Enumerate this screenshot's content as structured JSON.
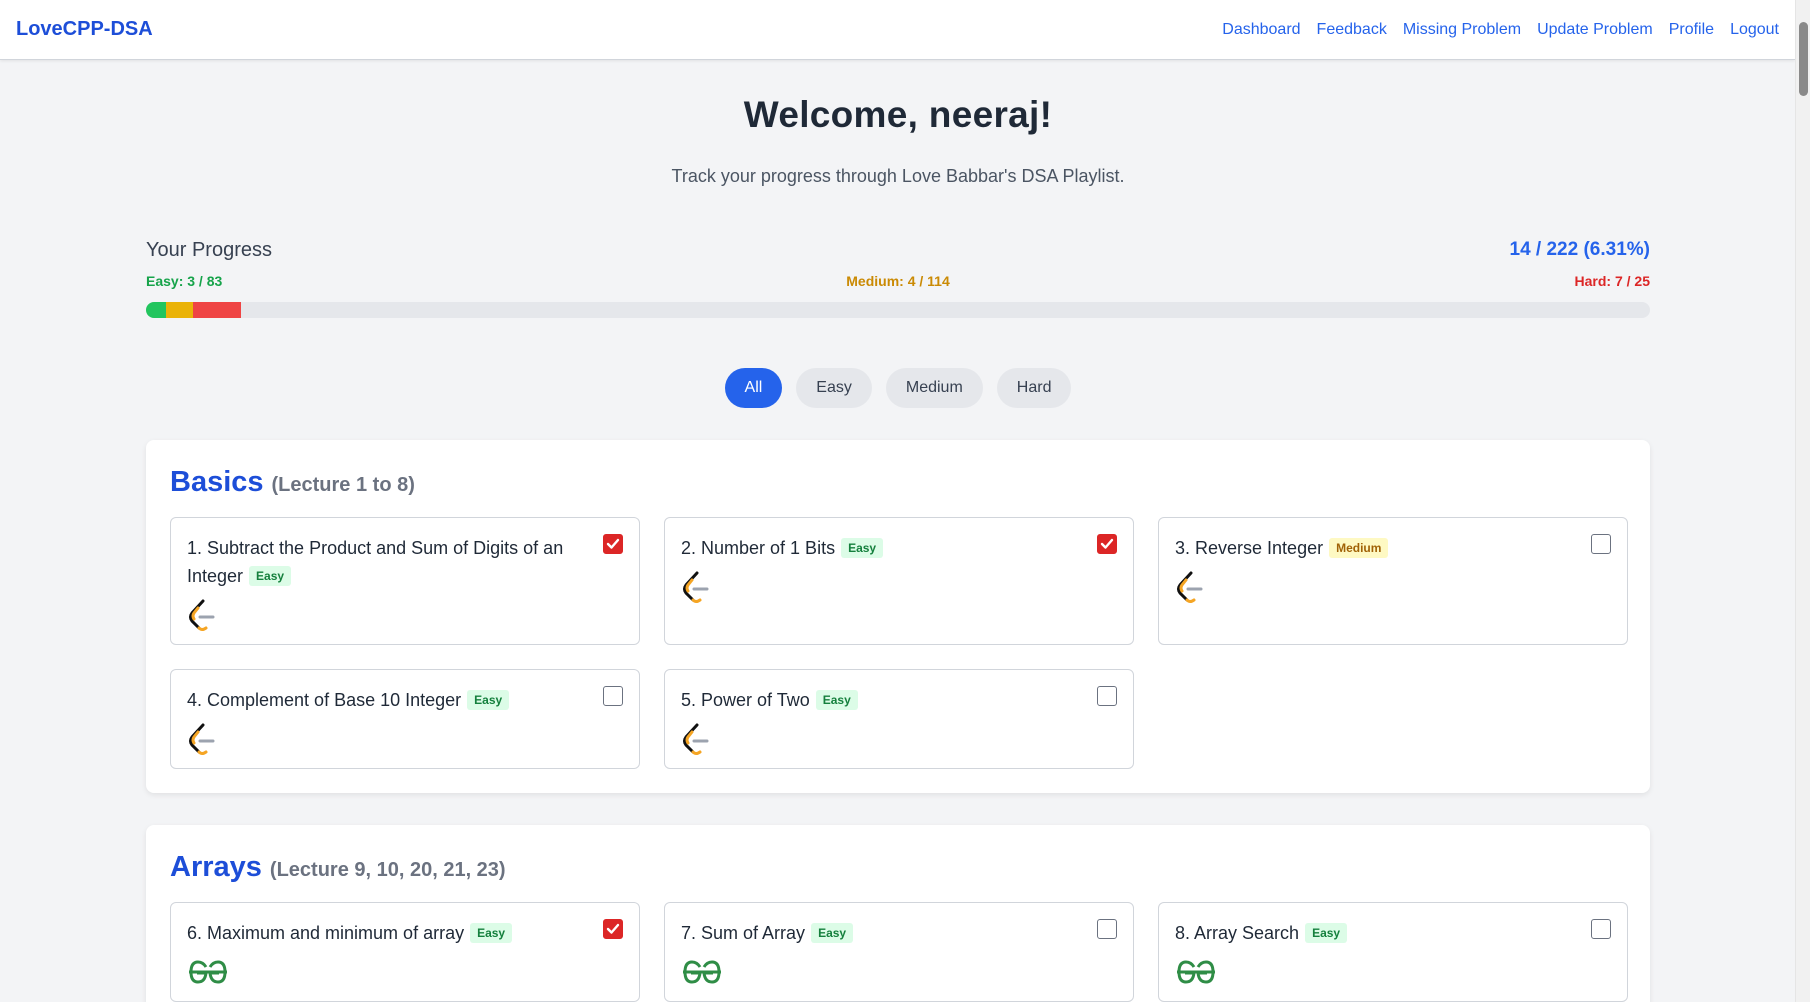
{
  "navbar": {
    "brand": "LoveCPP-DSA",
    "links": [
      "Dashboard",
      "Feedback",
      "Missing Problem",
      "Update Problem",
      "Profile",
      "Logout"
    ]
  },
  "welcome": "Welcome, neeraj!",
  "subtitle": "Track your progress through Love Babbar's DSA Playlist.",
  "progress": {
    "label": "Your Progress",
    "total": "14 / 222 (6.31%)",
    "easy_text": "Easy: 3 / 83",
    "medium_text": "Medium: 4 / 114",
    "hard_text": "Hard: 7 / 25",
    "easy_done": 3,
    "medium_done": 4,
    "hard_done": 7,
    "total_count": 222,
    "colors": {
      "easy": "#22c55e",
      "medium": "#eab308",
      "hard": "#ef4444"
    }
  },
  "filters": {
    "all": "All",
    "easy": "Easy",
    "medium": "Medium",
    "hard": "Hard",
    "active": "All"
  },
  "sections": [
    {
      "title": "Basics",
      "subtitle": "(Lecture 1 to 8)",
      "problems": [
        {
          "title": "1. Subtract the Product and Sum of Digits of an Integer",
          "difficulty": "Easy",
          "checked": true,
          "platform": "leetcode-icon"
        },
        {
          "title": "2. Number of 1 Bits",
          "difficulty": "Easy",
          "checked": true,
          "platform": "leetcode-icon"
        },
        {
          "title": "3. Reverse Integer",
          "difficulty": "Medium",
          "checked": false,
          "platform": "leetcode-icon"
        },
        {
          "title": "4. Complement of Base 10 Integer",
          "difficulty": "Easy",
          "checked": false,
          "platform": "leetcode-icon"
        },
        {
          "title": "5. Power of Two",
          "difficulty": "Easy",
          "checked": false,
          "platform": "leetcode-icon"
        }
      ]
    },
    {
      "title": "Arrays",
      "subtitle": "(Lecture 9, 10, 20, 21, 23)",
      "problems": [
        {
          "title": "6. Maximum and minimum of array",
          "difficulty": "Easy",
          "checked": true,
          "platform": "geeksforgeeks-icon"
        },
        {
          "title": "7. Sum of Array",
          "difficulty": "Easy",
          "checked": false,
          "platform": "geeksforgeeks-icon"
        },
        {
          "title": "8. Array Search",
          "difficulty": "Easy",
          "checked": false,
          "platform": "geeksforgeeks-icon"
        }
      ]
    }
  ]
}
